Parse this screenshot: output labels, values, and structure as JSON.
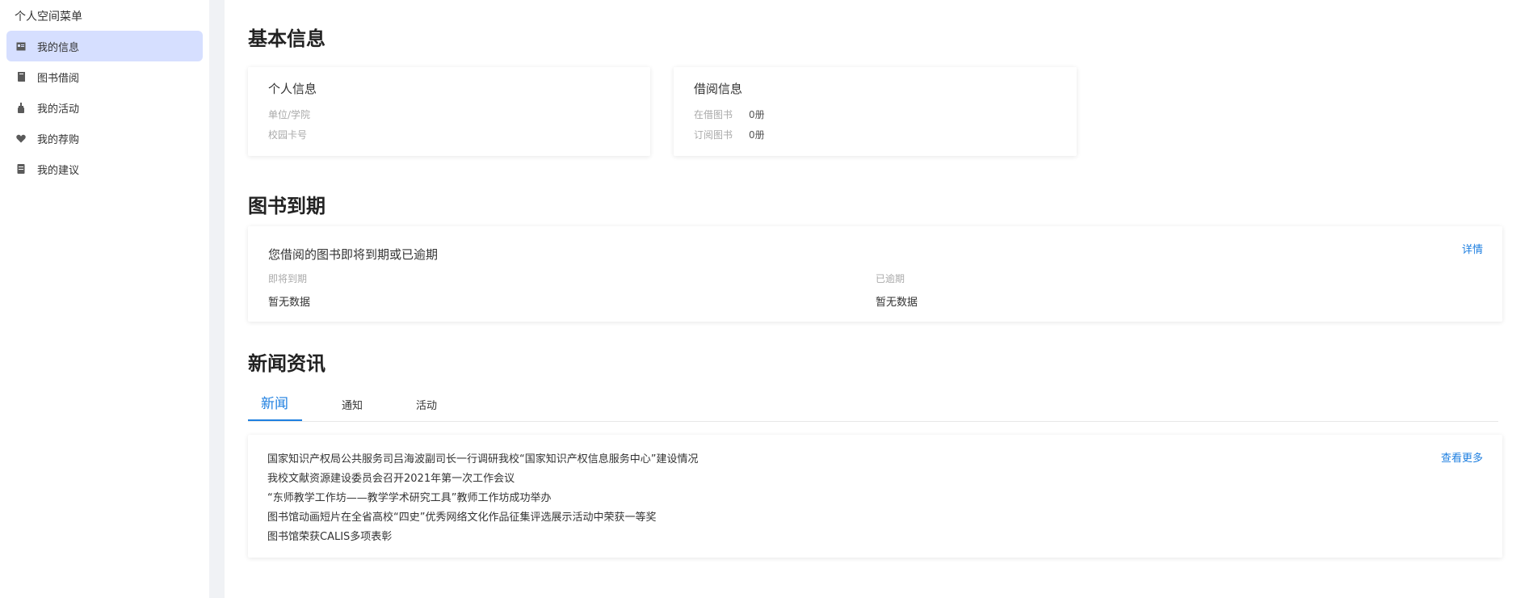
{
  "sidebar": {
    "title": "个人空间菜单",
    "items": [
      {
        "label": "我的信息",
        "icon": "profile-card-icon"
      },
      {
        "label": "图书借阅",
        "icon": "book-icon"
      },
      {
        "label": "我的活动",
        "icon": "activity-icon"
      },
      {
        "label": "我的荐购",
        "icon": "heart-icon"
      },
      {
        "label": "我的建议",
        "icon": "note-icon"
      }
    ]
  },
  "basic": {
    "title": "基本信息",
    "personal": {
      "title": "个人信息",
      "unit_label": "单位/学院",
      "card_label": "校园卡号"
    },
    "borrow": {
      "title": "借阅信息",
      "current_label": "在借图书",
      "current_value": "0册",
      "reserved_label": "订阅图书",
      "reserved_value": "0册"
    }
  },
  "due": {
    "title": "图书到期",
    "card_title": "您借阅的图书即将到期或已逾期",
    "detail_link": "详情",
    "soon_label": "即将到期",
    "soon_value": "暂无数据",
    "overdue_label": "已逾期",
    "overdue_value": "暂无数据"
  },
  "news": {
    "title": "新闻资讯",
    "tabs": [
      "新闻",
      "通知",
      "活动"
    ],
    "more_link": "查看更多",
    "items": [
      "国家知识产权局公共服务司吕海波副司长一行调研我校“国家知识产权信息服务中心”建设情况",
      "我校文献资源建设委员会召开2021年第一次工作会议",
      "“东师教学工作坊——教学学术研究工具”教师工作坊成功举办",
      "图书馆动画短片在全省高校“四史”优秀网络文化作品征集评选展示活动中荣获一等奖",
      "图书馆荣获CALIS多项表彰"
    ]
  },
  "colors": {
    "accent": "#1e7fe0",
    "active_menu_bg": "#d6dfff",
    "gutter": "#f0f2f5"
  }
}
